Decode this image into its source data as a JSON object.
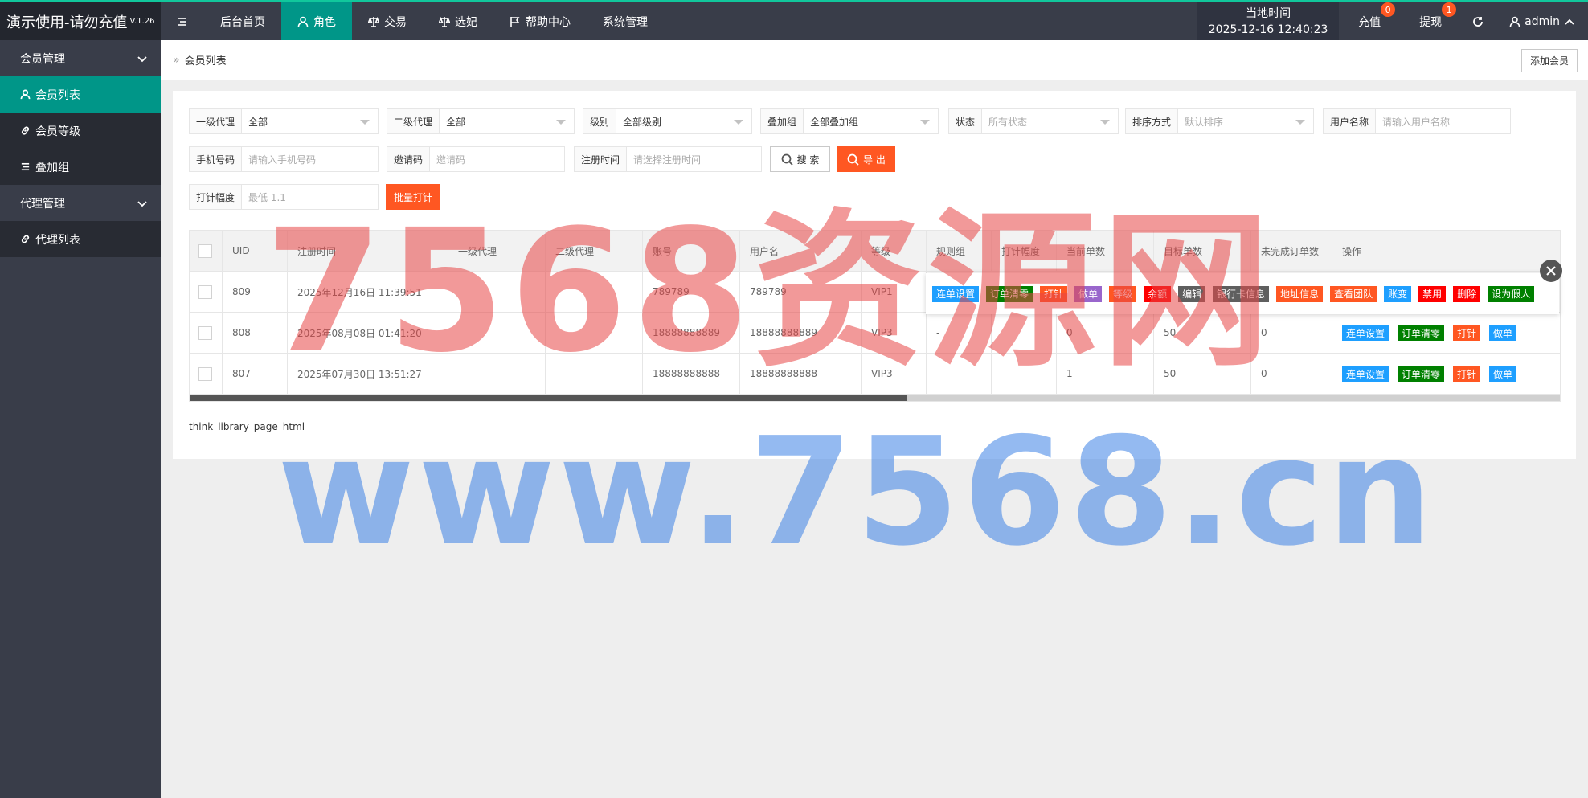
{
  "header": {
    "app_title": "演示使用-请勿充值",
    "version": "V.1.26",
    "nav": [
      {
        "label": "后台首页",
        "icon": "none"
      },
      {
        "label": "角色",
        "icon": "user-icon"
      },
      {
        "label": "交易",
        "icon": "scale-icon"
      },
      {
        "label": "选妃",
        "icon": "scale-icon"
      },
      {
        "label": "帮助中心",
        "icon": "flag-icon"
      },
      {
        "label": "系统管理",
        "icon": "none"
      }
    ],
    "clock_label": "当地时间",
    "clock_value": "2025-12-16 12:40:23",
    "recharge_label": "充值",
    "recharge_badge": "0",
    "withdraw_label": "提现",
    "withdraw_badge": "1",
    "user_label": "admin"
  },
  "sidebar": {
    "group1": "会员管理",
    "items1": [
      "会员列表",
      "会员等级",
      "叠加组"
    ],
    "group2": "代理管理",
    "items2": [
      "代理列表"
    ]
  },
  "page": {
    "breadcrumb": "会员列表",
    "add_button": "添加会员"
  },
  "filters": {
    "agent1_label": "一级代理",
    "agent1_value": "全部",
    "agent2_label": "二级代理",
    "agent2_value": "全部",
    "level_label": "级别",
    "level_value": "全部级别",
    "group_label": "叠加组",
    "group_value": "全部叠加组",
    "status_label": "状态",
    "status_placeholder": "所有状态",
    "sort_label": "排序方式",
    "sort_placeholder": "默认排序",
    "username_label": "用户名称",
    "username_placeholder": "请输入用户名称",
    "phone_label": "手机号码",
    "phone_placeholder": "请输入手机号码",
    "invite_label": "邀请码",
    "invite_placeholder": "邀请码",
    "regtime_label": "注册时间",
    "regtime_placeholder": "请选择注册时间",
    "search_button": "搜 索",
    "export_button": "导 出",
    "range_label": "打针幅度",
    "range_placeholder": "最低 1.1",
    "batch_button": "批量打针"
  },
  "table": {
    "columns": [
      "UID",
      "注册时间",
      "一级代理",
      "二级代理",
      "账号",
      "用户名",
      "等级",
      "规则组",
      "打针幅度",
      "当前单数",
      "目标单数",
      "未完成订单数",
      "操作"
    ],
    "rows": [
      {
        "uid": "809",
        "regtime": "2025年12月16日 11:39:51",
        "agent1": "",
        "agent2": "",
        "account": "789789",
        "username": "789789",
        "level": "VIP1",
        "rule": "",
        "range": "",
        "current": "",
        "target": "",
        "unfinished": ""
      },
      {
        "uid": "808",
        "regtime": "2025年08月08日 01:41:20",
        "agent1": "",
        "agent2": "",
        "account": "18888888889",
        "username": "18888888889",
        "level": "VIP3",
        "rule": "-",
        "range": "",
        "current": "0",
        "target": "50",
        "unfinished": "0"
      },
      {
        "uid": "807",
        "regtime": "2025年07月30日 13:51:27",
        "agent1": "",
        "agent2": "",
        "account": "18888888888",
        "username": "18888888888",
        "level": "VIP3",
        "rule": "-",
        "range": "",
        "current": "1",
        "target": "50",
        "unfinished": "0"
      }
    ],
    "row_actions": [
      "连单设置",
      "订单清零",
      "打针",
      "做单"
    ],
    "expanded_actions": [
      "连单设置",
      "订单清零",
      "打针",
      "做单",
      "等级",
      "余额",
      "编辑",
      "银行卡信息",
      "地址信息",
      "查看团队",
      "账变",
      "禁用",
      "删除",
      "设为假人"
    ],
    "scroll_fraction": 0.523
  },
  "pager_text": "think_library_page_html",
  "watermark": {
    "line1": "7568资源网",
    "line2": "www.7568.cn"
  },
  "colors": {
    "accent": "#009688",
    "header_bg": "#393d49",
    "danger": "#ff5722"
  }
}
